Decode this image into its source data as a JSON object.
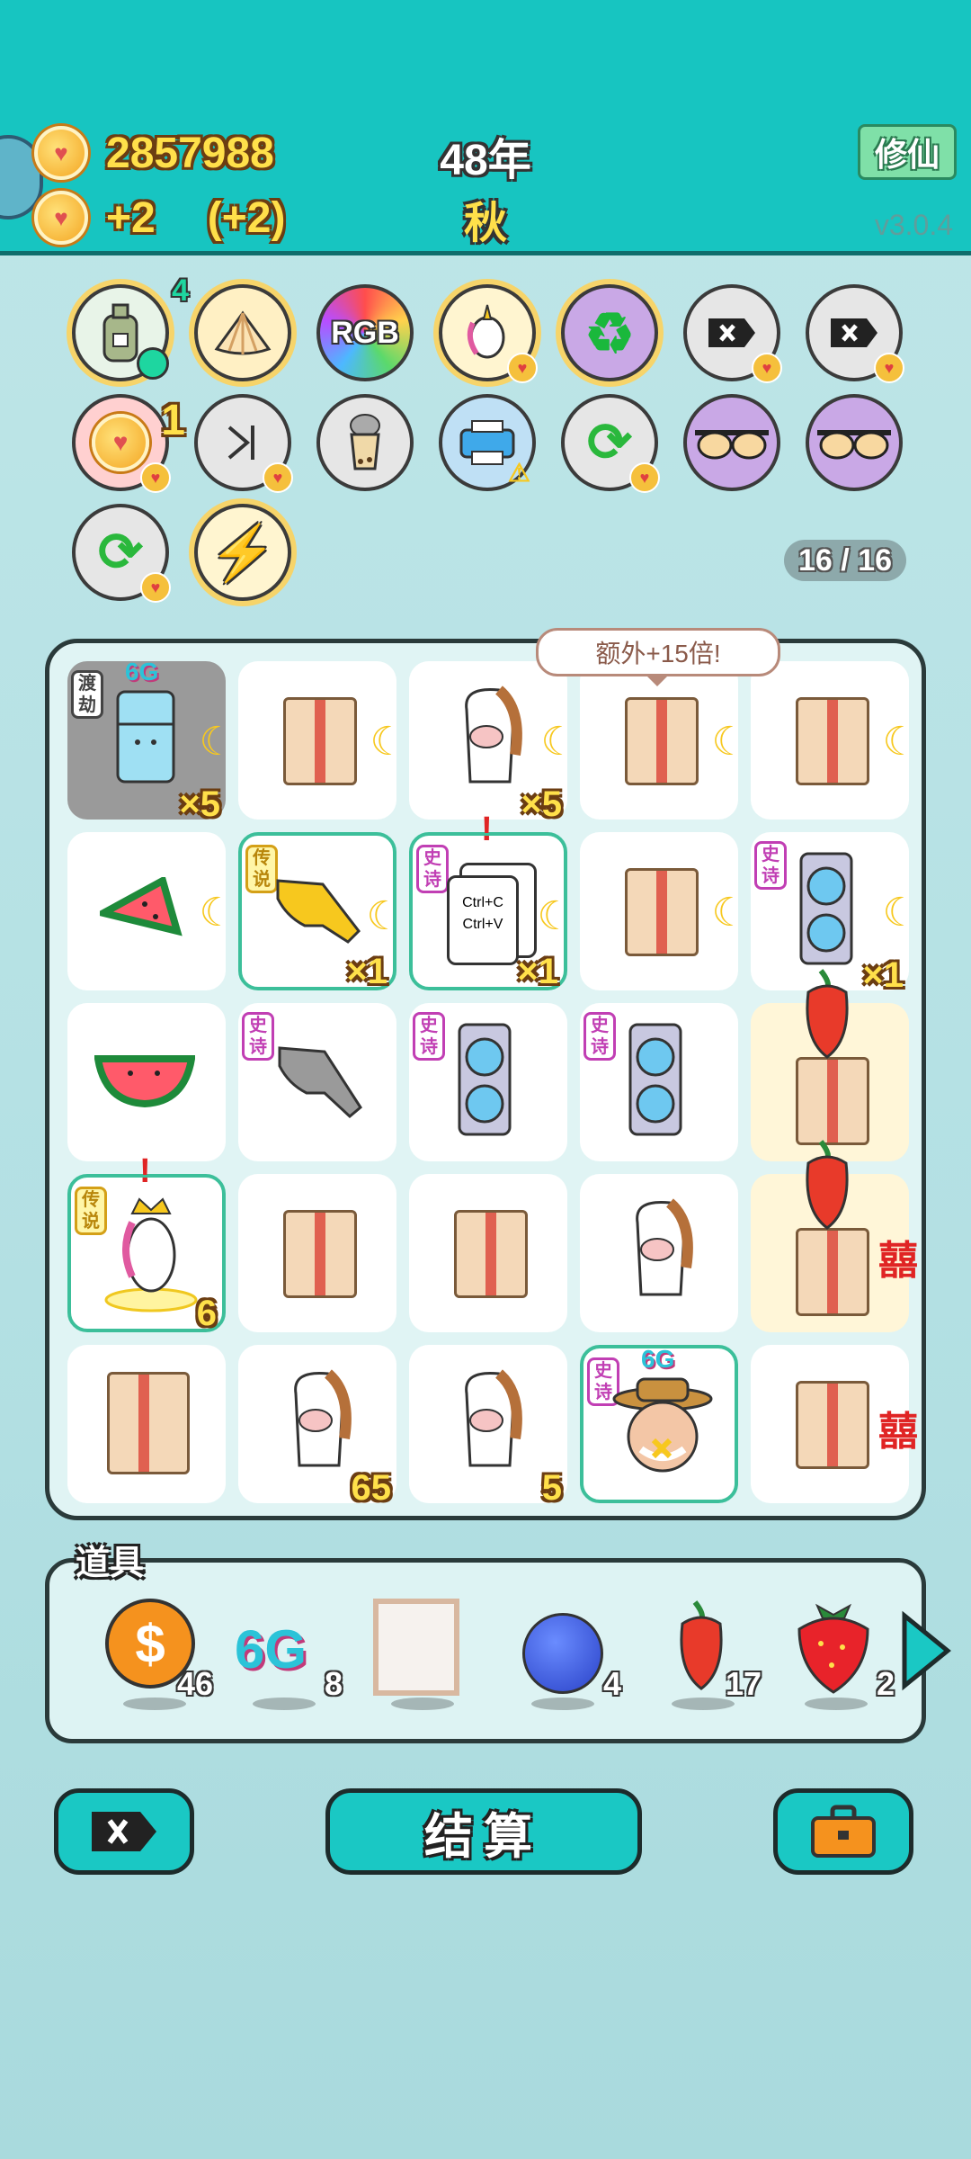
{
  "header": {
    "coins": "2857988",
    "income": "+2",
    "income_bonus": "(+2)",
    "year": "48年",
    "season": "秋",
    "cultivate_button": "修仙",
    "version": "v3.0.4"
  },
  "relics": [
    {
      "name": "sack",
      "badge": "4"
    },
    {
      "name": "shell"
    },
    {
      "name": "rgb",
      "label": "RGB"
    },
    {
      "name": "unicorn"
    },
    {
      "name": "recycle"
    },
    {
      "name": "remove"
    },
    {
      "name": "remove"
    },
    {
      "name": "coin-stack",
      "badge": "1"
    },
    {
      "name": "skip"
    },
    {
      "name": "bubble-tea"
    },
    {
      "name": "printer"
    },
    {
      "name": "refresh"
    },
    {
      "name": "sunglasses"
    },
    {
      "name": "sunglasses"
    },
    {
      "name": "refresh"
    },
    {
      "name": "lightning"
    }
  ],
  "deck_counter": "16 / 16",
  "tooltip": "额外+15倍!",
  "tags": {
    "epic": "史诗",
    "legend": "传说",
    "dujie": "渡劫"
  },
  "board": {
    "cells": [
      {
        "item": "fridge",
        "tag": "渡劫",
        "sixg": "6G",
        "mult": "×5",
        "moon": true,
        "gray": true
      },
      {
        "item": "box",
        "moon": true
      },
      {
        "item": "horse",
        "mult": "×5",
        "moon": true
      },
      {
        "item": "box",
        "moon": true
      },
      {
        "item": "box",
        "moon": true
      },
      {
        "item": "watermelon-slice",
        "moon": true
      },
      {
        "item": "pointing-hand-gold",
        "tag": "传说",
        "mult": "×1",
        "moon": true,
        "selected": true
      },
      {
        "item": "ctrl-c-v",
        "tag": "史诗",
        "mult": "×1",
        "moon": true,
        "selected": true,
        "ctrl_c": "Ctrl+C",
        "ctrl_v": "Ctrl+V"
      },
      {
        "item": "box",
        "moon": true
      },
      {
        "item": "gpu",
        "tag": "史诗",
        "mult": "×1",
        "moon": true
      },
      {
        "item": "watermelon"
      },
      {
        "item": "pointing-hand-gray",
        "tag": "史诗"
      },
      {
        "item": "gpu",
        "tag": "史诗"
      },
      {
        "item": "gpu",
        "tag": "史诗"
      },
      {
        "item": "box-chili"
      },
      {
        "item": "unicorn-king",
        "tag": "传说",
        "mult": "6",
        "selected": true
      },
      {
        "item": "box"
      },
      {
        "item": "box"
      },
      {
        "item": "horse"
      },
      {
        "item": "box-chili",
        "xi": "囍"
      },
      {
        "item": "box"
      },
      {
        "item": "horse",
        "mult": "65"
      },
      {
        "item": "horse",
        "mult": "5"
      },
      {
        "item": "old-man",
        "tag": "史诗",
        "sixg": "6G",
        "selected": true
      },
      {
        "item": "box",
        "xi": "囍"
      }
    ]
  },
  "items_panel": {
    "title": "道具",
    "items": [
      {
        "name": "coin",
        "count": "46"
      },
      {
        "name": "6g",
        "label": "6G",
        "count": "8"
      },
      {
        "name": "frame",
        "count": ""
      },
      {
        "name": "blueberry",
        "count": "4"
      },
      {
        "name": "chili",
        "count": "17"
      },
      {
        "name": "strawberry",
        "count": "2"
      }
    ]
  },
  "buttons": {
    "settle": "结算"
  },
  "colors": {
    "header_bg": "#17c5c1",
    "page_bg": "#b3e0e3",
    "coin_text": "#ffe04a",
    "epic": "#c13fb4",
    "legend": "#d4a017"
  }
}
